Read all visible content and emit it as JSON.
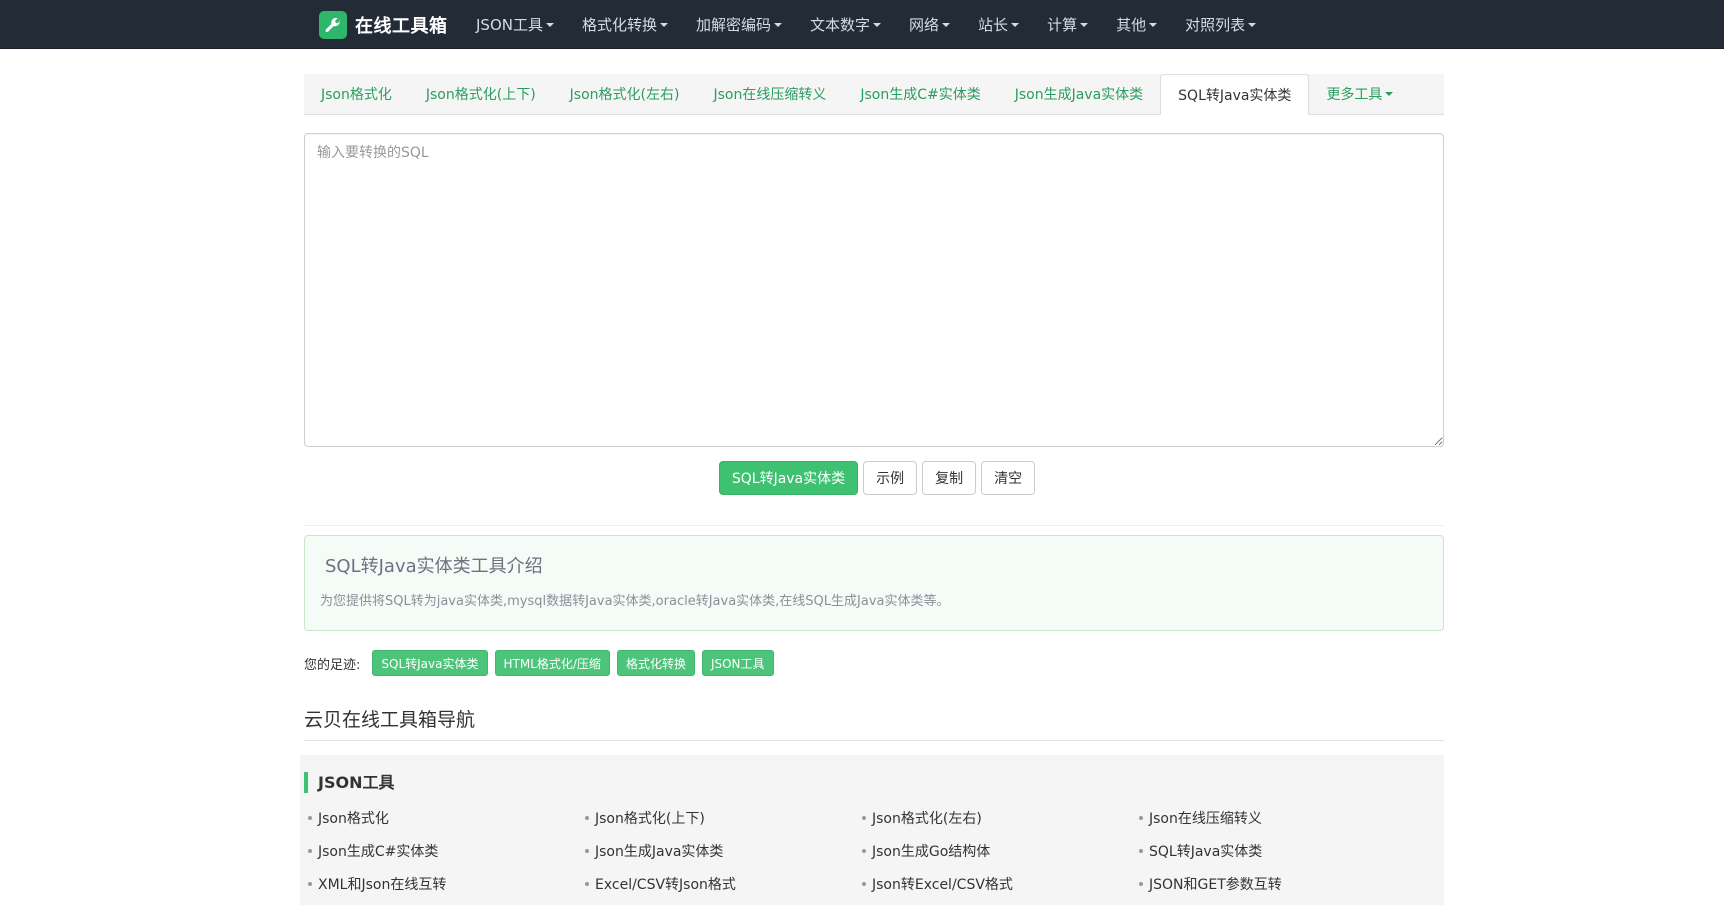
{
  "brand": {
    "name": "在线工具箱",
    "icon": "wrench-icon",
    "accent": "#2eb66a"
  },
  "nav": [
    {
      "label": "JSON工具"
    },
    {
      "label": "格式化转换"
    },
    {
      "label": "加解密编码"
    },
    {
      "label": "文本数字"
    },
    {
      "label": "网络"
    },
    {
      "label": "站长"
    },
    {
      "label": "计算"
    },
    {
      "label": "其他"
    },
    {
      "label": "对照列表"
    }
  ],
  "tabs": [
    "Json格式化",
    "Json格式化(上下)",
    "Json格式化(左右)",
    "Json在线压缩转义",
    "Json生成C#实体类",
    "Json生成Java实体类",
    "SQL转Java实体类",
    "更多工具"
  ],
  "active_tab": "SQL转Java实体类",
  "input": {
    "placeholder": "输入要转换的SQL",
    "value": ""
  },
  "buttons": {
    "convert": "SQL转Java实体类",
    "example": "示例",
    "copy": "复制",
    "clear": "清空"
  },
  "intro": {
    "title": "SQL转Java实体类工具介绍",
    "description": "为您提供将SQL转为java实体类,mysql数据转Java实体类,oracle转Java实体类,在线SQL生成Java实体类等。"
  },
  "footprint": {
    "label": "您的足迹:",
    "tags": [
      "SQL转Java实体类",
      "HTML格式化/压缩",
      "格式化转换",
      "JSON工具"
    ]
  },
  "navigation": {
    "heading": "云贝在线工具箱导航",
    "section_title": "JSON工具",
    "tools": [
      "Json格式化",
      "Json格式化(上下)",
      "Json格式化(左右)",
      "Json在线压缩转义",
      "Json生成C#实体类",
      "Json生成Java实体类",
      "Json生成Go结构体",
      "SQL转Java实体类",
      "XML和Json在线互转",
      "Excel/CSV转Json格式",
      "Json转Excel/CSV格式",
      "JSON和GET参数互转"
    ]
  },
  "colors": {
    "navbar_bg": "#232b36",
    "primary_green": "#3fc172",
    "tab_link": "#2a9d5f"
  }
}
